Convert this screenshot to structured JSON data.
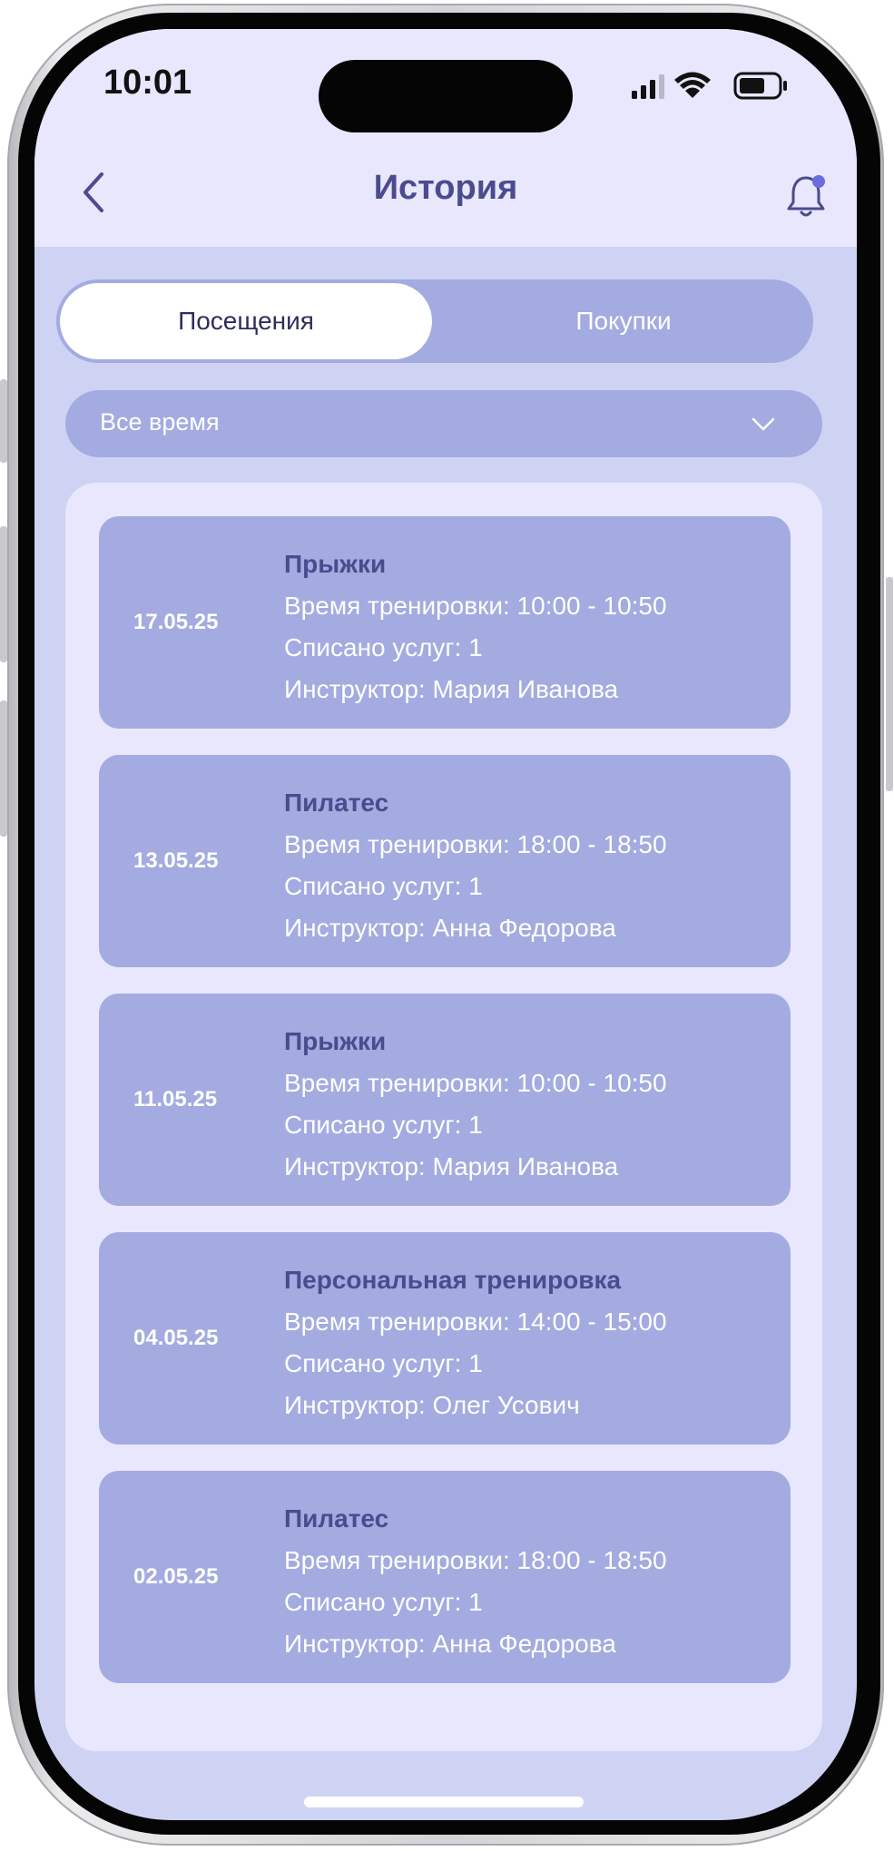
{
  "status_bar": {
    "time": "10:01"
  },
  "nav": {
    "title": "История",
    "back_icon": "chevron-left-icon",
    "bell_icon": "bell-icon"
  },
  "tabs": [
    {
      "label": "Посещения",
      "active": true
    },
    {
      "label": "Покупки",
      "active": false
    }
  ],
  "filter": {
    "period": "Все время"
  },
  "visits": [
    {
      "date": "17.05.25",
      "title": "Прыжки",
      "time": "Время тренировки: 10:00 - 10:50",
      "services": "Списано услуг: 1",
      "instructor": "Инструктор: Мария Иванова"
    },
    {
      "date": "13.05.25",
      "title": "Пилатес",
      "time": "Время тренировки: 18:00 - 18:50",
      "services": "Списано услуг: 1",
      "instructor": "Инструктор: Анна Федорова"
    },
    {
      "date": "11.05.25",
      "title": "Прыжки",
      "time": "Время тренировки: 10:00 - 10:50",
      "services": "Списано услуг: 1",
      "instructor": "Инструктор: Мария Иванова"
    },
    {
      "date": "04.05.25",
      "title": "Персональная тренировка",
      "time": "Время тренировки: 14:00 - 15:00",
      "services": "Списано услуг: 1",
      "instructor": "Инструктор: Олег Усович"
    },
    {
      "date": "02.05.25",
      "title": "Пилатес",
      "time": "Время тренировки: 18:00 - 18:50",
      "services": "Списано услуг: 1",
      "instructor": "Инструктор: Анна Федорова"
    }
  ],
  "colors": {
    "accent": "#4b4b8f",
    "card": "#a3abe0",
    "panel": "#e8e7fd",
    "background": "#cfd3f3",
    "notification_dot": "#6b6be0"
  }
}
